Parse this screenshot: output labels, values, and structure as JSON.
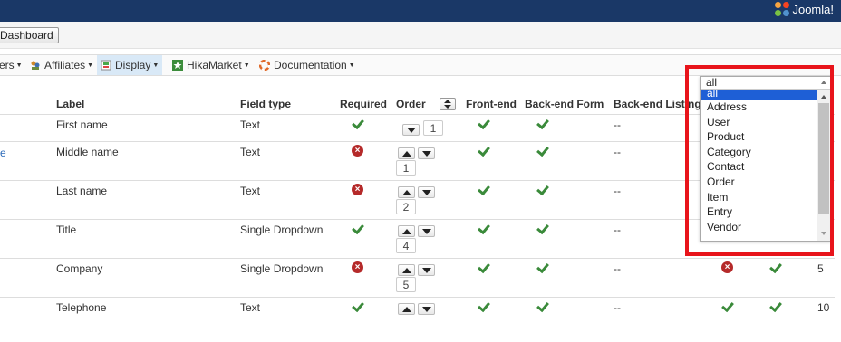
{
  "topbar": {
    "brand": "Joomla!"
  },
  "toolbar": {
    "dashboard_label": "Dashboard"
  },
  "menu": {
    "items": [
      {
        "label": "ers",
        "icon": ""
      },
      {
        "label": "Affiliates",
        "icon": "affiliates-icon"
      },
      {
        "label": "Display",
        "icon": "display-icon"
      },
      {
        "label": "HikaMarket",
        "icon": "hikamarket-icon"
      },
      {
        "label": "Documentation",
        "icon": "lifebuoy-icon"
      }
    ]
  },
  "table": {
    "headers": {
      "label": "Label",
      "field_type": "Field type",
      "required": "Required",
      "order": "Order",
      "front_end": "Front-end",
      "back_end_form": "Back-end Form",
      "back_end_listing": "Back-end Listing"
    },
    "rows": [
      {
        "prefix": "",
        "label": "First name",
        "type": "Text",
        "required": true,
        "order": "1",
        "front": true,
        "back_form": true,
        "listing": "--"
      },
      {
        "prefix": "e",
        "label": "Middle name",
        "type": "Text",
        "required": false,
        "order": "1",
        "front": true,
        "back_form": true,
        "listing": "--"
      },
      {
        "prefix": "",
        "label": "Last name",
        "type": "Text",
        "required": false,
        "order": "2",
        "front": true,
        "back_form": true,
        "listing": "--"
      },
      {
        "prefix": "",
        "label": "Title",
        "type": "Single Dropdown",
        "required": true,
        "order": "4",
        "front": true,
        "back_form": true,
        "listing": "--"
      },
      {
        "prefix": "",
        "label": "Company",
        "type": "Single Dropdown",
        "required": false,
        "order": "5",
        "front": true,
        "back_form": true,
        "listing": "--",
        "extra": [
          "bad",
          "ok",
          "5"
        ]
      },
      {
        "prefix": "",
        "label": "Telephone",
        "type": "Text",
        "required": true,
        "order": "",
        "front": true,
        "back_form": true,
        "listing": "--",
        "extra": [
          "ok",
          "ok",
          "10"
        ]
      }
    ]
  },
  "filter_dropdown": {
    "selected": "all",
    "options": [
      "all",
      "Address",
      "User",
      "Product",
      "Category",
      "Contact",
      "Order",
      "Item",
      "Entry",
      "Vendor"
    ]
  },
  "colors": {
    "topbar": "#1a3867",
    "highlight": "#1e5fd6",
    "annotation": "#e8141b",
    "check": "#3a8a3a",
    "error": "#b52a2a"
  }
}
